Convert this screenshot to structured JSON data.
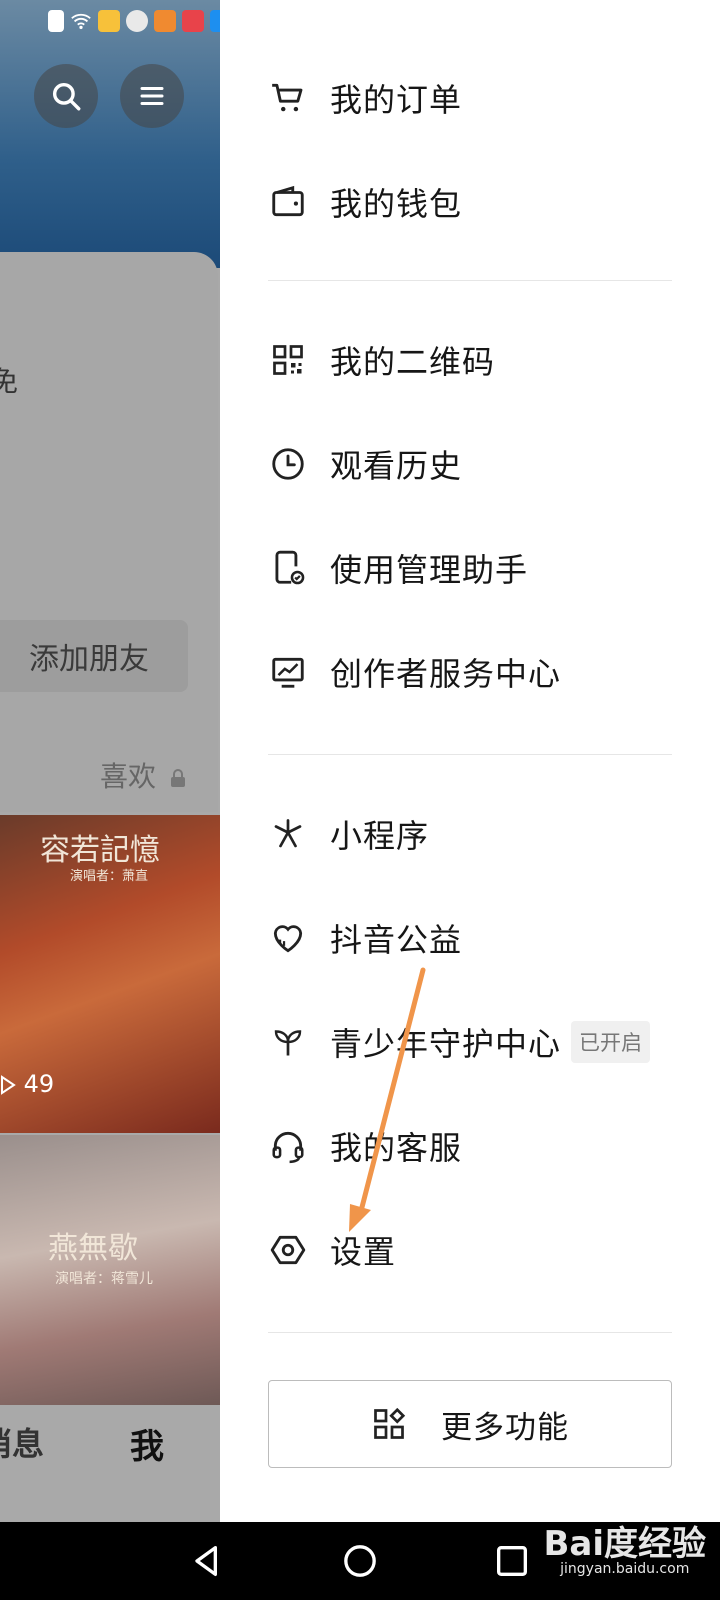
{
  "background_app": {
    "add_friend_label": "添加朋友",
    "likes_tab_label": "喜欢",
    "thumb1_title": "容若記憶",
    "thumb1_singer": "演唱者：萧直",
    "thumb1_count": "49",
    "thumb2_title": "燕無歇",
    "thumb2_singer": "演唱者：蒋雪儿",
    "nav_messages_fragment": "消息",
    "nav_me_label": "我",
    "partial_text": "免"
  },
  "drawer": {
    "items": [
      {
        "label": "我的订单",
        "icon": "cart-icon"
      },
      {
        "label": "我的钱包",
        "icon": "wallet-icon"
      },
      {
        "label": "我的二维码",
        "icon": "qrcode-icon"
      },
      {
        "label": "观看历史",
        "icon": "clock-icon"
      },
      {
        "label": "使用管理助手",
        "icon": "phone-check-icon"
      },
      {
        "label": "创作者服务中心",
        "icon": "monitor-chart-icon"
      },
      {
        "label": "小程序",
        "icon": "mini-program-icon"
      },
      {
        "label": "抖音公益",
        "icon": "heart-icon"
      },
      {
        "label": "青少年守护中心",
        "icon": "sprout-icon",
        "badge": "已开启"
      },
      {
        "label": "我的客服",
        "icon": "headset-icon"
      },
      {
        "label": "设置",
        "icon": "settings-hexagon-icon"
      }
    ],
    "more_button_label": "更多功能"
  },
  "watermark": {
    "brand": "Bai度经验",
    "url": "jingyan.baidu.com"
  },
  "colors": {
    "annotation_arrow": "#f0954a",
    "drawer_bg": "#ffffff",
    "dim_overlay": "#a9a9a9"
  }
}
